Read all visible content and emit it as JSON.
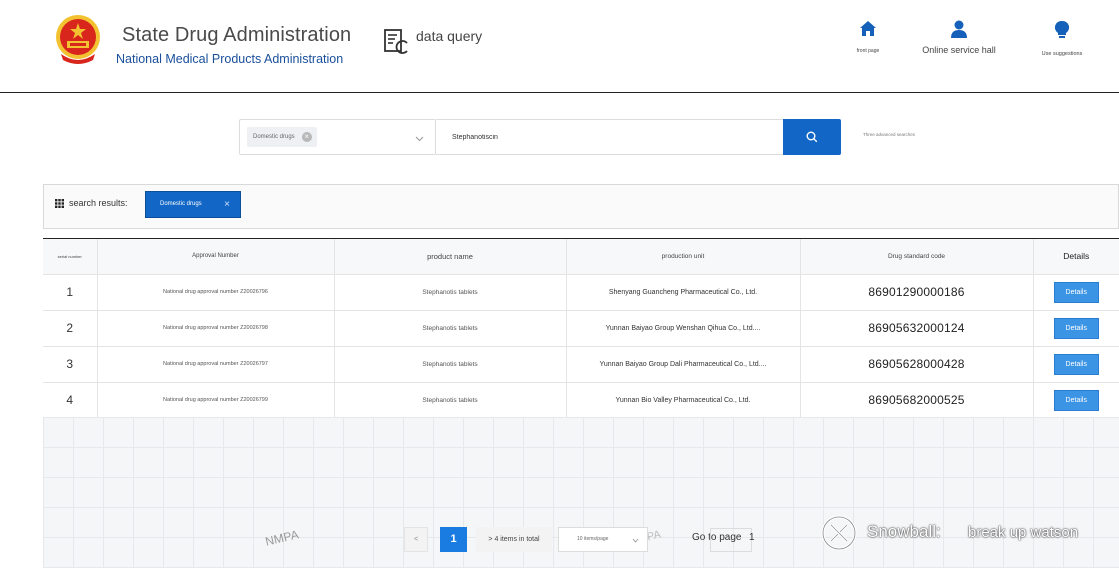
{
  "header": {
    "title": "State Drug Administration",
    "subtitle": "National Medical Products Administration",
    "data_query": "data query",
    "nav": [
      {
        "label": "front page",
        "icon": "home-icon"
      },
      {
        "label": "Online service hall",
        "icon": "user-icon"
      },
      {
        "label": "Use suggestions",
        "icon": "lightbulb-icon"
      }
    ]
  },
  "search": {
    "category_tag": "Domestic drugs",
    "query": "Stephanotiscin",
    "advanced": "Three advanced searches"
  },
  "results": {
    "label": "search results:",
    "filter_chip": "Domestic drugs"
  },
  "table": {
    "columns": [
      "serial number",
      "Approval Number",
      "product name",
      "production unit",
      "Drug standard code",
      "Details"
    ],
    "rows": [
      {
        "serial": "1",
        "approval": "National drug approval number Z20026796",
        "product": "Stephanotis tablets",
        "unit": "Shenyang Guancheng Pharmaceutical Co., Ltd.",
        "code": "86901290000186",
        "details": "Details"
      },
      {
        "serial": "2",
        "approval": "National drug approval number Z20026798",
        "product": "Stephanotis tablets",
        "unit": "Yunnan Baiyao Group Wenshan Qihua Co., Ltd....",
        "code": "86905632000124",
        "details": "Details"
      },
      {
        "serial": "3",
        "approval": "National drug approval number Z20026797",
        "product": "Stephanotis tablets",
        "unit": "Yunnan Baiyao Group Dali Pharmaceutical Co., Ltd....",
        "code": "86905628000428",
        "details": "Details"
      },
      {
        "serial": "4",
        "approval": "National drug approval number Z20026799",
        "product": "Stephanotis tablets",
        "unit": "Yunnan Bio Valley Pharmaceutical Co., Ltd.",
        "code": "86905682000525",
        "details": "Details"
      }
    ]
  },
  "pagination": {
    "prev": "<",
    "current_page": "1",
    "total": "> 4 items in total",
    "page_size": "10 items/page",
    "goto_label": "Go to page",
    "goto_value": "1"
  },
  "watermarks": {
    "nmpa": "NMPA",
    "nmpa_partial": "PA",
    "snowball_name": "Snowball:",
    "snowball_user": "break up watson"
  },
  "colors": {
    "primary": "#1267c6",
    "details_button": "#3c94e4",
    "subtitle": "#1a4f9c",
    "emblem_red": "#d9261c",
    "emblem_gold": "#f2c230"
  }
}
